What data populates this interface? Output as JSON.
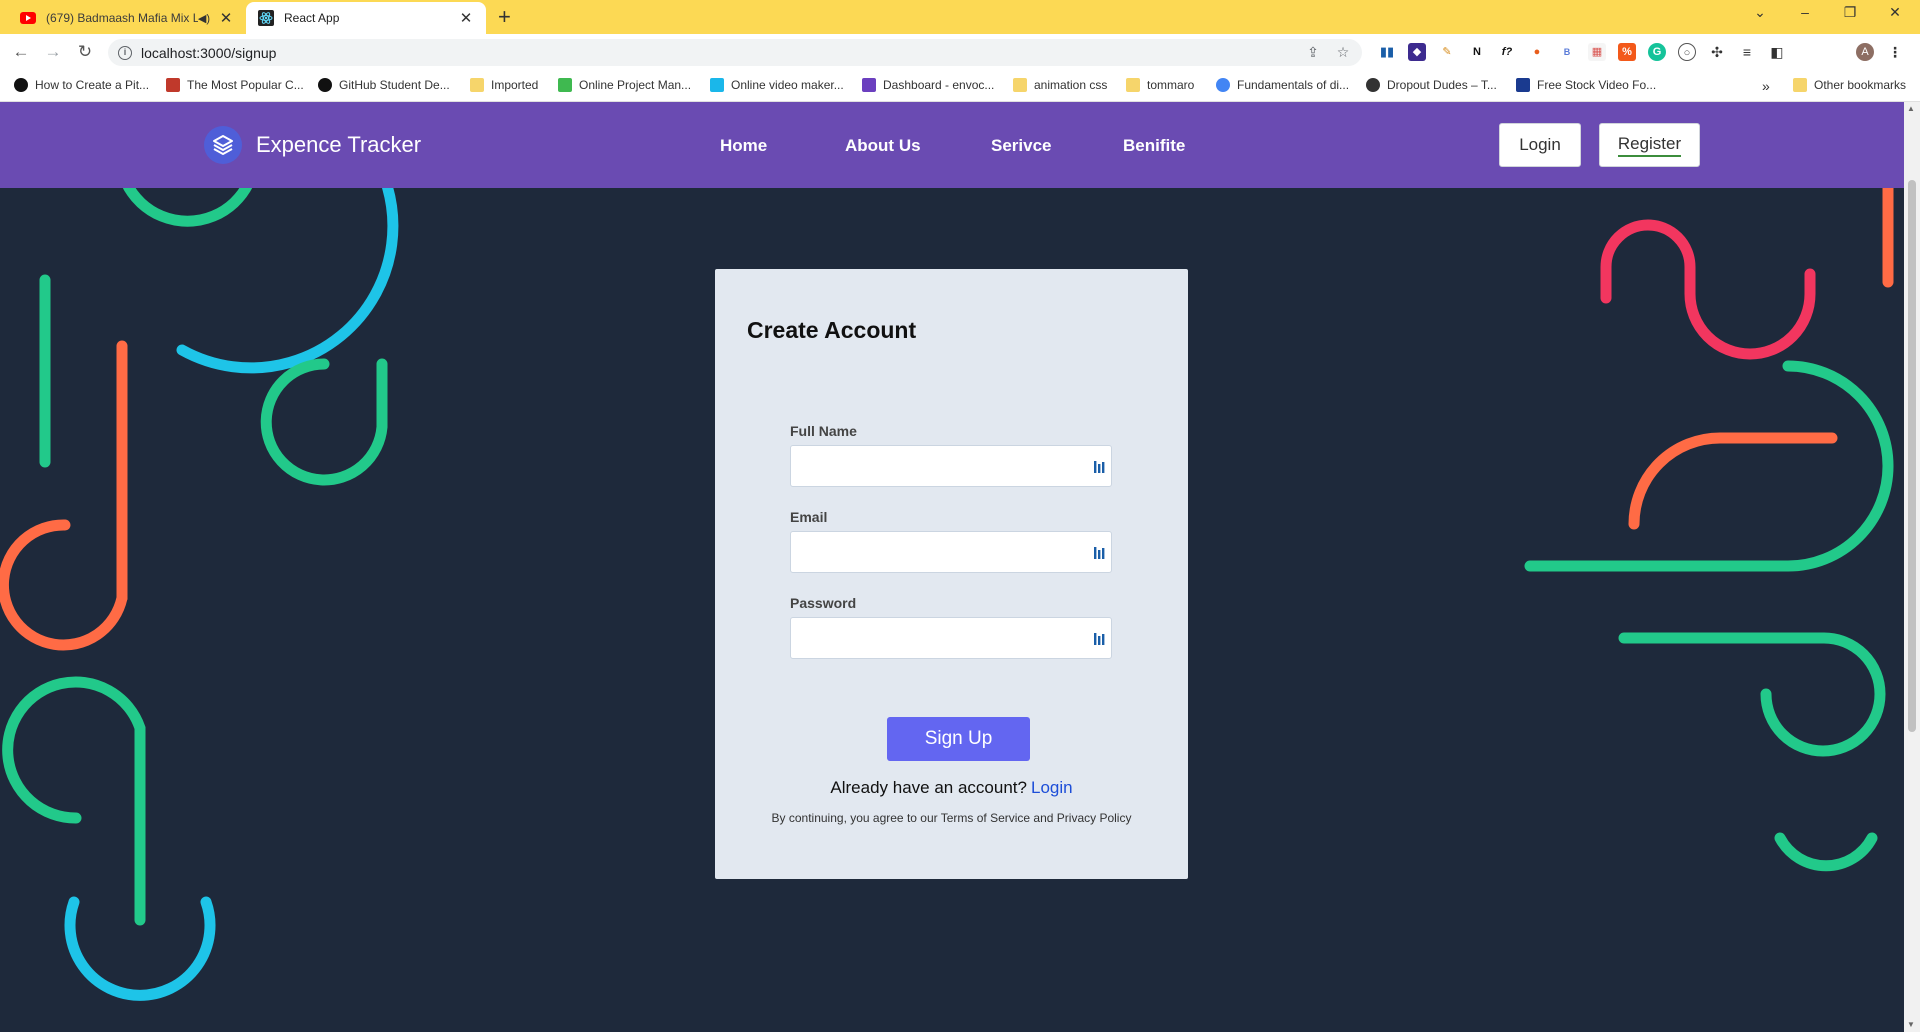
{
  "browser": {
    "tabs": [
      {
        "title": "(679) Badmaash Mafia Mix Ly",
        "favicon": "youtube-icon",
        "active": false
      },
      {
        "title": "React App",
        "favicon": "react-icon",
        "active": true
      }
    ],
    "url": "localhost:3000/signup",
    "bookmarks": [
      "How to Create a Pit...",
      "The Most Popular C...",
      "GitHub Student De...",
      "Imported",
      "Online Project Man...",
      "Online video maker...",
      "Dashboard - envoc...",
      "animation css",
      "tommaro",
      "Fundamentals of di...",
      "Dropout Dudes – T...",
      "Free Stock Video Fo..."
    ],
    "overflow": "»",
    "other_bookmarks": "Other bookmarks",
    "profile_initial": "A"
  },
  "navbar": {
    "brand": "Expence Tracker",
    "links": [
      "Home",
      "About Us",
      "Serivce",
      "Benifite"
    ],
    "login_label": "Login",
    "register_label": "Register"
  },
  "form": {
    "title": "Create Account",
    "fields": [
      {
        "label": "Full Name",
        "value": ""
      },
      {
        "label": "Email",
        "value": ""
      },
      {
        "label": "Password",
        "value": ""
      }
    ],
    "submit_label": "Sign Up",
    "already_text": "Already have an account?",
    "login_link": "Login",
    "terms_text": "By continuing, you agree to our Terms of Service and Privacy Policy"
  },
  "colors": {
    "browser_frame": "#fcd954",
    "navbar": "#6a4bb2",
    "background": "#1e293b",
    "card": "#e2e8f0",
    "primary_button": "#6366f1",
    "link": "#1d4ed8",
    "deco_green": "#22c98a",
    "deco_cyan": "#1ec4e8",
    "deco_orange": "#ff6b45",
    "deco_red": "#f2365f"
  }
}
